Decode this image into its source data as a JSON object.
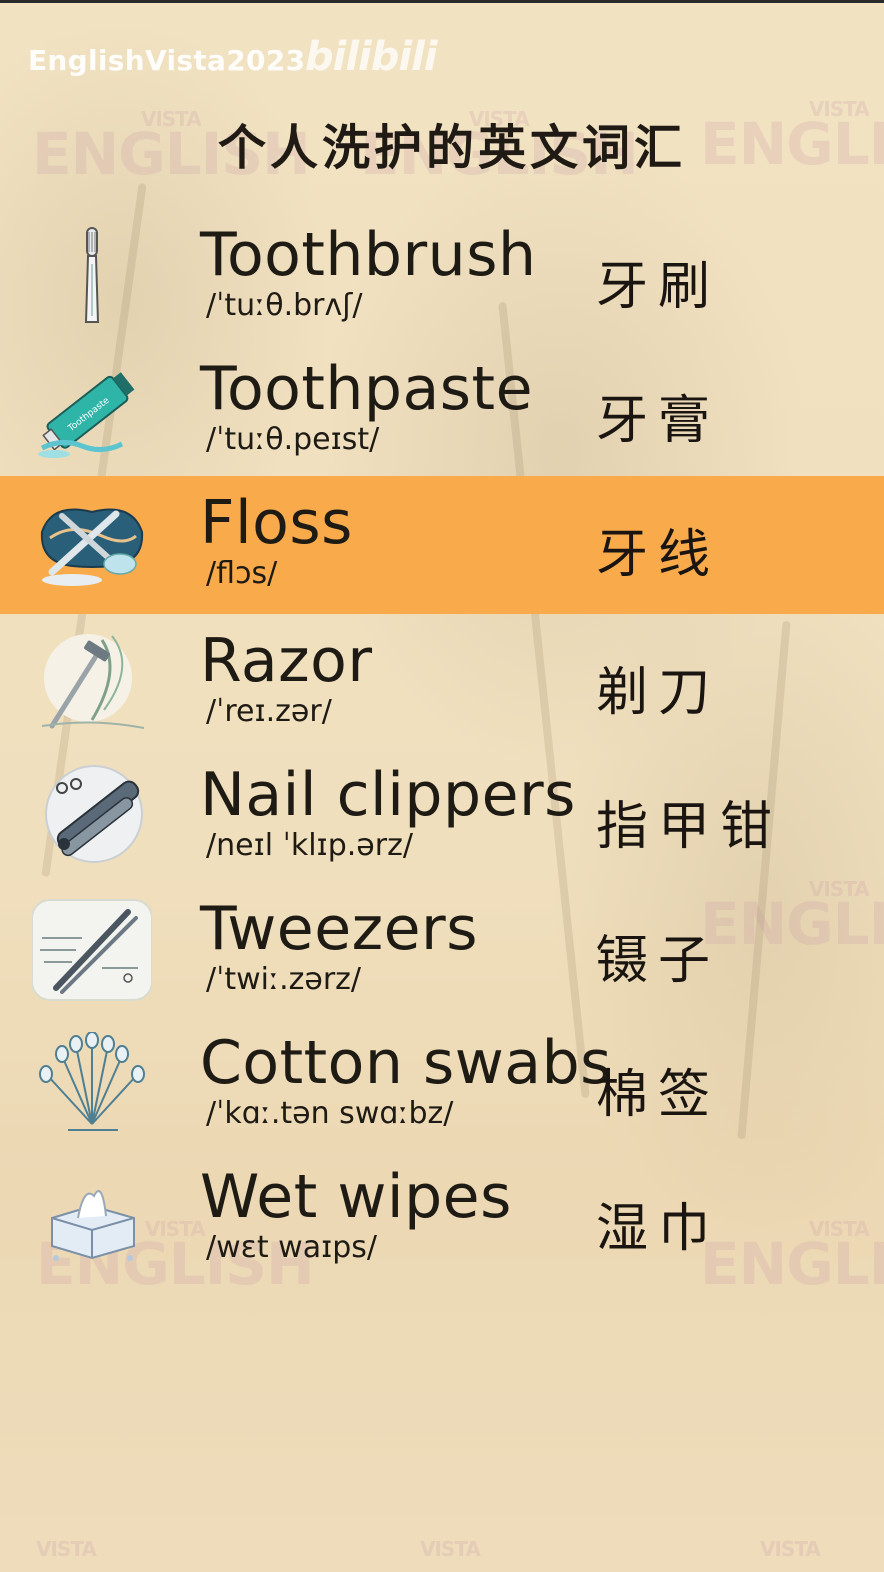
{
  "header": {
    "channel": "EnglishVista2023",
    "platform_logo": "bilibili",
    "title": "个人洗护的英文词汇"
  },
  "watermark": {
    "top": "VISTA",
    "bottom": "ENGLISH"
  },
  "items": [
    {
      "en": "Toothbrush",
      "ipa": "/ˈtuːθ.brʌʃ/",
      "zh": "牙刷",
      "icon": "toothbrush-icon"
    },
    {
      "en": "Toothpaste",
      "ipa": "/ˈtuːθ.peɪst/",
      "zh": "牙膏",
      "icon": "toothpaste-icon",
      "tube_text": "Toothpaste"
    },
    {
      "en": "Floss",
      "ipa": "/flɔs/",
      "zh": "牙线",
      "icon": "floss-icon",
      "highlighted": true
    },
    {
      "en": "Razor",
      "ipa": "/ˈreɪ.zər/",
      "zh": "剃刀",
      "icon": "razor-icon"
    },
    {
      "en": "Nail clippers",
      "ipa": "/neɪl ˈklɪp.ərz/",
      "zh": "指甲钳",
      "icon": "nail-clippers-icon"
    },
    {
      "en": "Tweezers",
      "ipa": "/ˈtwiː.zərz/",
      "zh": "镊子",
      "icon": "tweezers-icon"
    },
    {
      "en": "Cotton swabs",
      "ipa": "/ˈkɑː.tən swɑːbz/",
      "zh": "棉签",
      "icon": "cotton-swabs-icon"
    },
    {
      "en": "Wet wipes",
      "ipa": "/wɛt waɪps/",
      "zh": "湿巾",
      "icon": "wet-wipes-icon"
    }
  ],
  "colors": {
    "highlight": "#f9aa4a",
    "background": "#f2e4c6",
    "text": "#1e1a14"
  }
}
